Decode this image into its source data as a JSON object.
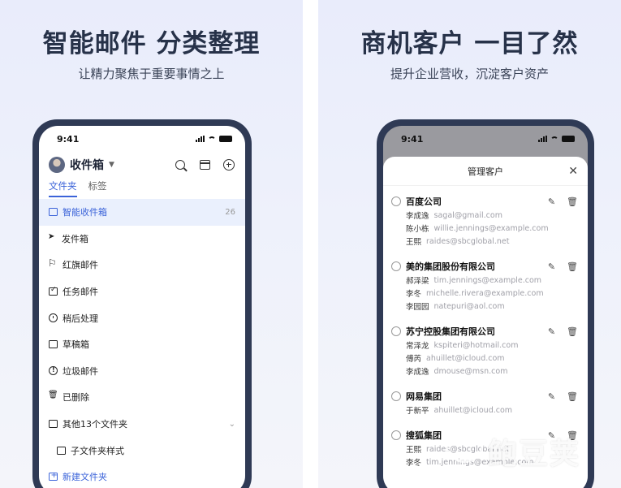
{
  "left_panel": {
    "headline": "智能邮件 分类整理",
    "subline": "让精力聚焦于重要事情之上",
    "status_time": "9:41",
    "mailbox_title": "收件箱",
    "tabs": [
      {
        "label": "文件夹"
      },
      {
        "label": "标签"
      }
    ],
    "folders": [
      {
        "label": "智能收件箱",
        "count": "26"
      },
      {
        "label": "发件箱"
      },
      {
        "label": "红旗邮件"
      },
      {
        "label": "任务邮件"
      },
      {
        "label": "稍后处理"
      },
      {
        "label": "草稿箱"
      },
      {
        "label": "垃圾邮件"
      },
      {
        "label": "已删除"
      },
      {
        "label": "其他13个文件夹"
      },
      {
        "label": "子文件夹样式"
      },
      {
        "label": "新建文件夹"
      }
    ]
  },
  "right_panel": {
    "headline": "商机客户 一目了然",
    "subline": "提升企业营收，沉淀客户资产",
    "status_time": "9:41",
    "sheet_title": "管理客户",
    "companies": [
      {
        "name": "百度公司",
        "contacts": [
          {
            "name": "李成逸",
            "email": "sagal@gmail.com"
          },
          {
            "name": "陈小栋",
            "email": "willie.jennings@example.com"
          },
          {
            "name": "王熙",
            "email": "raides@sbcglobal.net"
          }
        ]
      },
      {
        "name": "美的集团股份有限公司",
        "contacts": [
          {
            "name": "郝泽梁",
            "email": "tim.jennings@example.com"
          },
          {
            "name": "李冬",
            "email": "michelle.rivera@example.com"
          },
          {
            "name": "李园园",
            "email": "natepuri@aol.com"
          }
        ]
      },
      {
        "name": "苏宁控股集团有限公司",
        "contacts": [
          {
            "name": "常泽龙",
            "email": "kspiteri@hotmail.com"
          },
          {
            "name": "傅芮",
            "email": "ahuillet@icloud.com"
          },
          {
            "name": "李成逸",
            "email": "dmouse@msn.com"
          }
        ]
      },
      {
        "name": "网易集团",
        "contacts": [
          {
            "name": "于新平",
            "email": "ahuillet@icloud.com"
          }
        ]
      },
      {
        "name": "搜狐集团",
        "contacts": [
          {
            "name": "王熙",
            "email": "raides@sbcglobal.net"
          },
          {
            "name": "李冬",
            "email": "tim.jennings@example.com"
          }
        ]
      }
    ]
  },
  "watermark": {
    "text": "鲍豆荚"
  },
  "colors": {
    "accent": "#3b63d9",
    "phone_frame": "#2f3a55",
    "headline": "#273249"
  }
}
